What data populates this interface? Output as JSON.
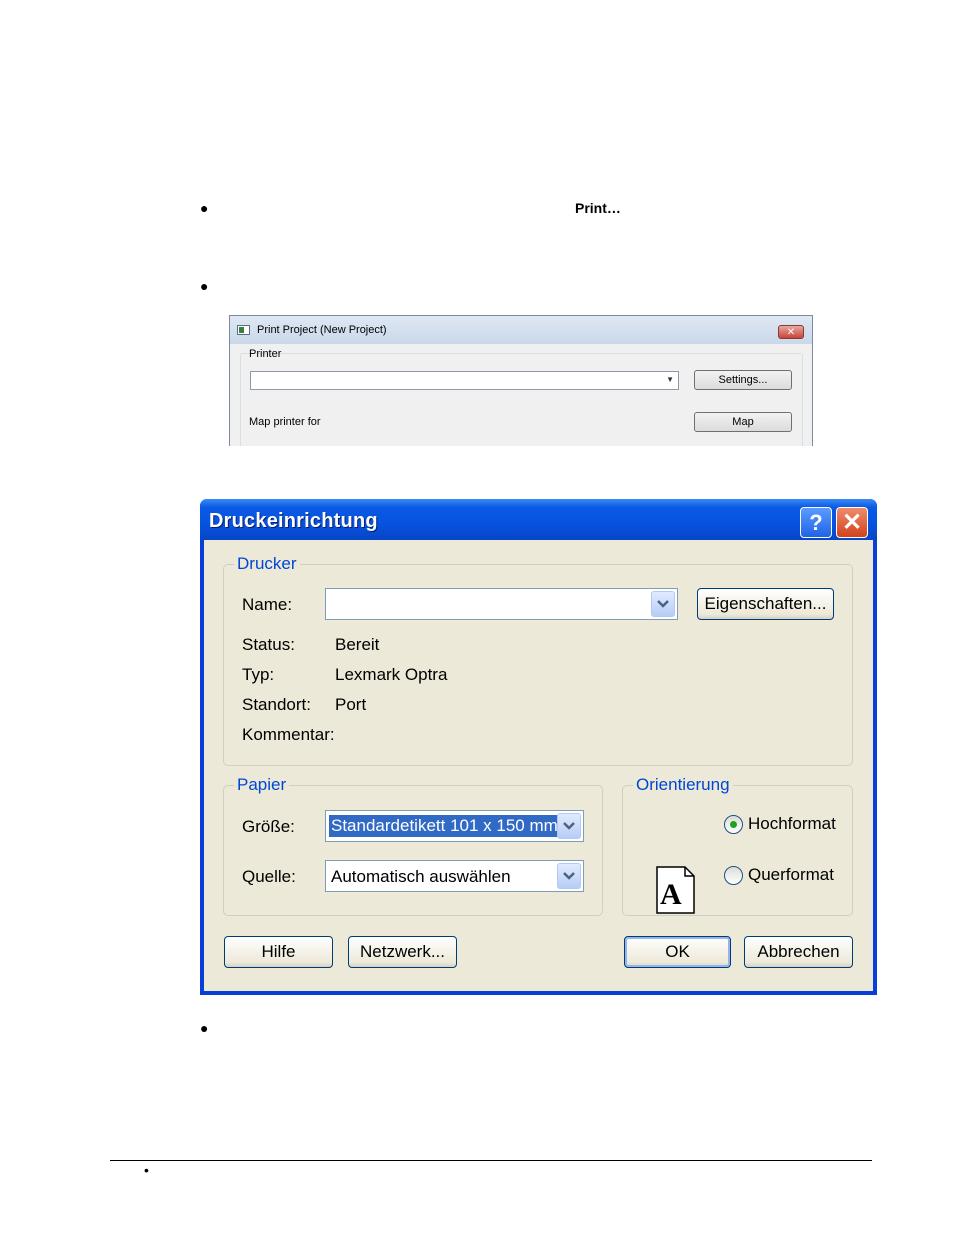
{
  "document": {
    "bullet_glyph": "●",
    "print_command": "Print…",
    "footer_bullet": "•"
  },
  "print_project_dialog": {
    "title": "Print Project (New Project)",
    "printer_label": "Printer",
    "printer_value": "",
    "settings_button": "Settings...",
    "map_printer_label": "Map printer for",
    "map_button": "Map"
  },
  "druckeinrichtung_dialog": {
    "title": "Druckeinrichtung",
    "help_button": "?",
    "close_button": "✕",
    "drucker_group": {
      "title": "Drucker",
      "name_label": "Name:",
      "name_value": "",
      "eigenschaften_button": "Eigenschaften...",
      "status_label": "Status:",
      "status_value": "Bereit",
      "typ_label": "Typ:",
      "typ_value": "Lexmark Optra",
      "standort_label": "Standort:",
      "standort_value": "Port",
      "kommentar_label": "Kommentar:",
      "kommentar_value": ""
    },
    "papier_group": {
      "title": "Papier",
      "groesse_label": "Größe:",
      "groesse_value": "Standardetikett 101 x 150 mm",
      "quelle_label": "Quelle:",
      "quelle_value": "Automatisch auswählen"
    },
    "orientierung_group": {
      "title": "Orientierung",
      "hochformat_label": "Hochformat",
      "querformat_label": "Querformat",
      "selected": "Hochformat",
      "icon_letter": "A"
    },
    "buttons": {
      "hilfe": "Hilfe",
      "netzwerk": "Netzwerk...",
      "ok": "OK",
      "abbrechen": "Abbrechen"
    }
  }
}
